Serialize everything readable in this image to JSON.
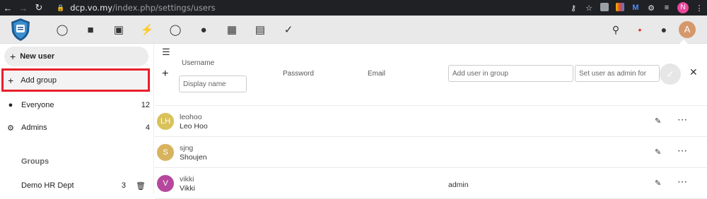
{
  "browser": {
    "url_host": "dcp.vo.my",
    "url_path": "/index.php/settings/users",
    "profile_initial": "N"
  },
  "header": {
    "avatar_initial": "A"
  },
  "sidebar": {
    "new_user": "New user",
    "add_group": "Add group",
    "items": [
      {
        "label": "Everyone",
        "count": "12"
      },
      {
        "label": "Admins",
        "count": "4"
      }
    ],
    "groups_caption": "Groups",
    "groups": [
      {
        "label": "Demo HR Dept",
        "count": "3"
      }
    ]
  },
  "new_user_form": {
    "username_label": "Username",
    "display_name_placeholder": "Display name",
    "password_label": "Password",
    "email_label": "Email",
    "group_placeholder": "Add user in group",
    "admin_placeholder": "Set user as admin for"
  },
  "users": [
    {
      "initials": "LH",
      "username": "leohoo",
      "display_name": "Leo Hoo",
      "group_admin": "",
      "color": "#d9c25a"
    },
    {
      "initials": "S",
      "username": "sjng",
      "display_name": "Shoujen",
      "group_admin": "",
      "color": "#d8b35e"
    },
    {
      "initials": "V",
      "username": "vikki",
      "display_name": "Vikki",
      "group_admin": "admin",
      "color": "#b5489c"
    }
  ],
  "colors": {
    "highlight_border": "#e8202a",
    "chrome_bg": "#202124",
    "header_bg": "#e9e9e9"
  }
}
